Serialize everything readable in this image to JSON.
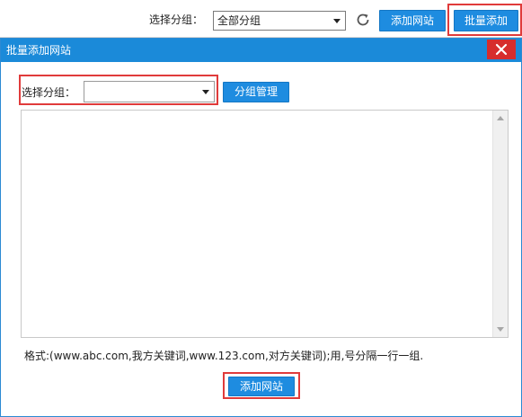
{
  "toolbar": {
    "group_label": "选择分组：",
    "group_select_value": "全部分组",
    "add_site_label": "添加网站",
    "batch_add_label": "批量添加"
  },
  "dialog": {
    "title": "批量添加网站",
    "group_label": "选择分组：",
    "group_select_value": "",
    "group_manage_label": "分组管理",
    "textarea_value": "",
    "hint": "格式:(www.abc.com,我方关键词,www.123.com,对方关键词);用,号分隔一行一组.",
    "submit_label": "添加网站"
  },
  "icons": {
    "refresh": "refresh-icon",
    "close": "close-icon",
    "dropdown": "chevron-down-icon"
  },
  "colors": {
    "accent": "#1e8ce0",
    "titlebar": "#1b8ad9",
    "close_bg": "#d62d2d",
    "highlight": "#e03b3b"
  }
}
